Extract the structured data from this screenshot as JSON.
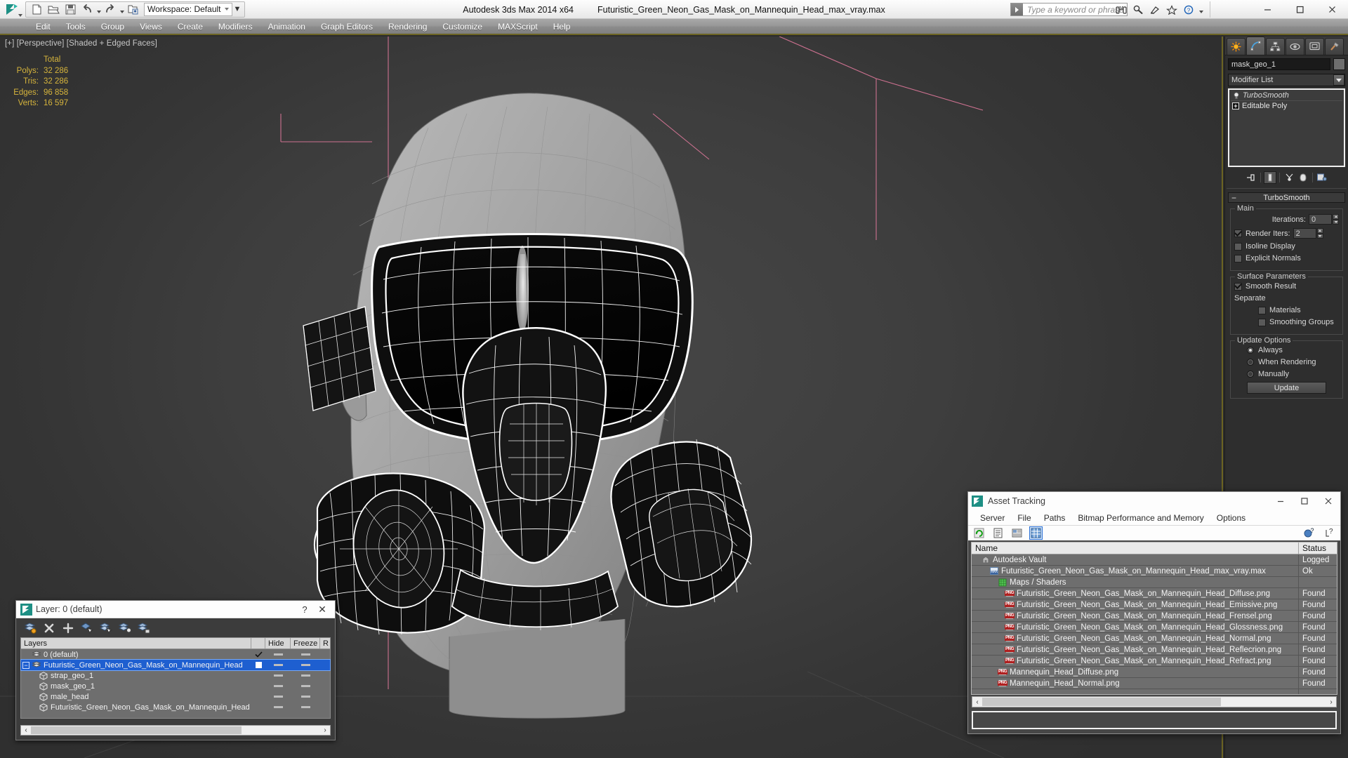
{
  "titlebar": {
    "app_title": "Autodesk 3ds Max  2014 x64",
    "document_title": "Futuristic_Green_Neon_Gas_Mask_on_Mannequin_Head_max_vray.max",
    "workspace_label": "Workspace: Default",
    "search_placeholder": "Type a keyword or phrase",
    "quick_access": [
      {
        "name": "new-scene-icon",
        "label": "New"
      },
      {
        "name": "open-file-icon",
        "label": "Open"
      },
      {
        "name": "save-file-icon",
        "label": "Save"
      },
      {
        "name": "undo-icon",
        "label": "Undo"
      },
      {
        "name": "redo-icon",
        "label": "Redo"
      },
      {
        "name": "set-project-folder-icon",
        "label": "Set Project Folder"
      }
    ],
    "infocenter_icons": [
      "binoculars-icon",
      "search-icon",
      "subscription-icon",
      "favorites-star-icon",
      "help-icon"
    ],
    "window_buttons": [
      "minimize",
      "maximize",
      "close"
    ]
  },
  "menubar": {
    "items": [
      "Edit",
      "Tools",
      "Group",
      "Views",
      "Create",
      "Modifiers",
      "Animation",
      "Graph Editors",
      "Rendering",
      "Customize",
      "MAXScript",
      "Help"
    ]
  },
  "viewport": {
    "label": "[+] [Perspective] [Shaded + Edged Faces]",
    "stats": {
      "header": "Total",
      "rows": [
        {
          "key": "Polys:",
          "value": "32 286"
        },
        {
          "key": "Tris:",
          "value": "32 286"
        },
        {
          "key": "Edges:",
          "value": "96 858"
        },
        {
          "key": "Verts:",
          "value": "16 597"
        }
      ]
    },
    "stats_color": "#d6b43c"
  },
  "command_panel": {
    "tabs": [
      {
        "name": "create-tab",
        "label": "Create"
      },
      {
        "name": "modify-tab",
        "label": "Modify"
      },
      {
        "name": "hierarchy-tab",
        "label": "Hierarchy"
      },
      {
        "name": "motion-tab",
        "label": "Motion"
      },
      {
        "name": "display-tab",
        "label": "Display"
      },
      {
        "name": "utilities-tab",
        "label": "Utilities"
      }
    ],
    "active_tab": "modify-tab",
    "object_name": "mask_geo_1",
    "modifier_list_label": "Modifier List",
    "stack": [
      {
        "label": "TurboSmooth",
        "italic": true
      },
      {
        "label": "Editable Poly",
        "italic": false
      }
    ],
    "stack_tools": [
      "pin-stack-icon",
      "show-end-result-icon",
      "make-unique-icon",
      "remove-modifier-icon",
      "configure-modifier-sets-icon"
    ],
    "rollout": {
      "title": "TurboSmooth",
      "groups": [
        {
          "title": "Main",
          "fields": [
            {
              "type": "spinner",
              "label": "Iterations:",
              "value": "0"
            },
            {
              "type": "spinner-check",
              "label": "Render Iters:",
              "value": "2",
              "checked": true
            },
            {
              "type": "check",
              "label": "Isoline Display",
              "checked": false
            },
            {
              "type": "check",
              "label": "Explicit Normals",
              "checked": false
            }
          ]
        },
        {
          "title": "Surface Parameters",
          "fields": [
            {
              "type": "check",
              "label": "Smooth Result",
              "checked": true
            },
            {
              "type": "text",
              "label": "Separate"
            },
            {
              "type": "check-indent",
              "label": "Materials",
              "checked": false
            },
            {
              "type": "check-indent",
              "label": "Smoothing Groups",
              "checked": false
            }
          ]
        },
        {
          "title": "Update Options",
          "fields": [
            {
              "type": "radio",
              "label": "Always",
              "checked": true
            },
            {
              "type": "radio",
              "label": "When Rendering",
              "checked": false
            },
            {
              "type": "radio",
              "label": "Manually",
              "checked": false
            },
            {
              "type": "button",
              "label": "Update"
            }
          ]
        }
      ]
    }
  },
  "layer_dialog": {
    "title": "Layer: 0 (default)",
    "help_label": "?",
    "close_label": "✕",
    "toolbar": [
      "create-new-layer-icon",
      "delete-layer-icon",
      "add-selection-icon",
      "select-objects-in-layer-icon",
      "select-highlighted-objects-icon",
      "highlight-selected-objects-icon",
      "hide-unhide-layer-icon"
    ],
    "columns": [
      "Layers",
      "",
      "Hide",
      "Freeze",
      "R"
    ],
    "rows": [
      {
        "name": "0 (default)",
        "indent": 0,
        "icon": "layer-icon",
        "mark": "check",
        "hide": "dash",
        "freeze": "dash",
        "selected": false,
        "expander": ""
      },
      {
        "name": "Futuristic_Green_Neon_Gas_Mask_on_Mannequin_Head",
        "indent": 0,
        "icon": "layer-icon",
        "mark": "box",
        "hide": "dash",
        "freeze": "dash",
        "selected": true,
        "expander": "minus"
      },
      {
        "name": "strap_geo_1",
        "indent": 1,
        "icon": "object-icon",
        "mark": "",
        "hide": "dash",
        "freeze": "dash",
        "selected": false,
        "expander": ""
      },
      {
        "name": "mask_geo_1",
        "indent": 1,
        "icon": "object-icon",
        "mark": "",
        "hide": "dash",
        "freeze": "dash",
        "selected": false,
        "expander": ""
      },
      {
        "name": "male_head",
        "indent": 1,
        "icon": "object-icon",
        "mark": "",
        "hide": "dash",
        "freeze": "dash",
        "selected": false,
        "expander": ""
      },
      {
        "name": "Futuristic_Green_Neon_Gas_Mask_on_Mannequin_Head",
        "indent": 1,
        "icon": "object-icon",
        "mark": "",
        "hide": "dash",
        "freeze": "dash",
        "selected": false,
        "expander": ""
      }
    ],
    "scroll_left": "‹",
    "scroll_right": "›"
  },
  "asset_tracking": {
    "title": "Asset Tracking",
    "menu": [
      "Server",
      "File",
      "Paths",
      "Bitmap Performance and Memory",
      "Options"
    ],
    "toolbar": [
      "refresh-icon",
      "list-view-icon",
      "path-view-icon",
      "grid-view-icon"
    ],
    "toolbar_right": [
      "help-vault-icon",
      "help-icon"
    ],
    "active_toolbar_button": "grid-view-icon",
    "columns": [
      "Name",
      "Status"
    ],
    "rows": [
      {
        "name": "Autodesk Vault",
        "status": "Logged",
        "indent": 0,
        "icon": "vault-icon"
      },
      {
        "name": "Futuristic_Green_Neon_Gas_Mask_on_Mannequin_Head_max_vray.max",
        "status": "Ok",
        "indent": 1,
        "icon": "max-file-icon"
      },
      {
        "name": "Maps / Shaders",
        "status": "",
        "indent": 2,
        "icon": "maps-shaders-icon"
      },
      {
        "name": "Futuristic_Green_Neon_Gas_Mask_on_Mannequin_Head_Diffuse.png",
        "status": "Found",
        "indent": 3,
        "icon": "png-icon"
      },
      {
        "name": "Futuristic_Green_Neon_Gas_Mask_on_Mannequin_Head_Emissive.png",
        "status": "Found",
        "indent": 3,
        "icon": "png-icon"
      },
      {
        "name": "Futuristic_Green_Neon_Gas_Mask_on_Mannequin_Head_Frensel.png",
        "status": "Found",
        "indent": 3,
        "icon": "png-icon"
      },
      {
        "name": "Futuristic_Green_Neon_Gas_Mask_on_Mannequin_Head_Glossness.png",
        "status": "Found",
        "indent": 3,
        "icon": "png-icon"
      },
      {
        "name": "Futuristic_Green_Neon_Gas_Mask_on_Mannequin_Head_Normal.png",
        "status": "Found",
        "indent": 3,
        "icon": "png-icon"
      },
      {
        "name": "Futuristic_Green_Neon_Gas_Mask_on_Mannequin_Head_Reflecrion.png",
        "status": "Found",
        "indent": 3,
        "icon": "png-icon"
      },
      {
        "name": "Futuristic_Green_Neon_Gas_Mask_on_Mannequin_Head_Refract.png",
        "status": "Found",
        "indent": 3,
        "icon": "png-icon"
      },
      {
        "name": "Mannequin_Head_Diffuse.png",
        "status": "Found",
        "indent": 2,
        "icon": "png-icon"
      },
      {
        "name": "Mannequin_Head_Normal.png",
        "status": "Found",
        "indent": 2,
        "icon": "png-icon"
      }
    ],
    "scroll_left": "‹",
    "scroll_right": "›"
  },
  "colors": {
    "accent_gold": "#6c6423",
    "selection_blue": "#1e5fd0",
    "stats_yellow": "#d6b43c",
    "panel_bg": "#2e2e2e",
    "viewport_bg": "#3e3e3e"
  }
}
